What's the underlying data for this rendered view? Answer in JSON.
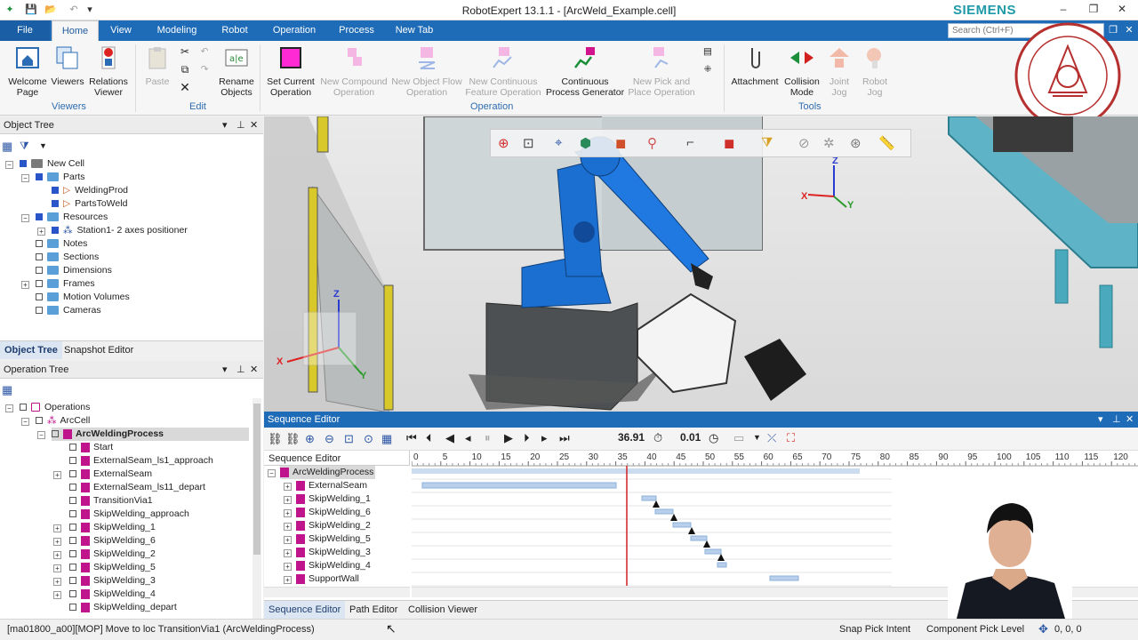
{
  "window": {
    "title": "RobotExpert 13.1.1 - [ArcWeld_Example.cell]",
    "brand": "SIEMENS",
    "minimize": "–",
    "restore": "❐",
    "close": "✕"
  },
  "tabs": [
    "File",
    "Home",
    "View",
    "Modeling",
    "Robot",
    "Operation",
    "Process",
    "New Tab"
  ],
  "search": {
    "placeholder": "Search (Ctrl+F)"
  },
  "ribbon": {
    "groups": [
      "Viewers",
      "Edit",
      "Operation",
      "Tools"
    ],
    "buttons": {
      "welcome": "Welcome Page",
      "viewers": "Viewers",
      "relations": "Relations Viewer",
      "paste": "Paste",
      "rename": "Rename Objects",
      "set_current": "Set Current Operation",
      "new_compound": "New Compound Operation",
      "new_object_flow": "New Object Flow Operation",
      "new_continuous": "New Continuous Feature Operation",
      "continuous_generator": "Continuous Process Generator",
      "new_pick_place": "New Pick and Place Operation",
      "attachment": "Attachment",
      "collision": "Collision Mode",
      "joint_jog": "Joint Jog",
      "robot_jog": "Robot Jog"
    }
  },
  "object_tree": {
    "title": "Object Tree",
    "items": [
      "New Cell",
      "Parts",
      "WeldingProd",
      "PartsToWeld",
      "Resources",
      "Station1- 2 axes positioner",
      "Notes",
      "Sections",
      "Dimensions",
      "Frames",
      "Motion Volumes",
      "Cameras"
    ],
    "bottom_tabs": [
      "Object Tree",
      "Snapshot Editor"
    ]
  },
  "operation_tree": {
    "title": "Operation Tree",
    "items": [
      "Operations",
      "ArcCell",
      "ArcWeldingProcess",
      "Start",
      "ExternalSeam_ls1_approach",
      "ExternalSeam",
      "ExternalSeam_ls11_depart",
      "TransitionVia1",
      "SkipWelding_approach",
      "SkipWelding_1",
      "SkipWelding_6",
      "SkipWelding_2",
      "SkipWelding_5",
      "SkipWelding_3",
      "SkipWelding_4",
      "SkipWelding_depart"
    ]
  },
  "viewport": {
    "axis_labels": [
      "Z",
      "X",
      "Y"
    ]
  },
  "sequence_editor": {
    "title": "Sequence Editor",
    "current_time": "36.91",
    "time_step": "0.01",
    "column_header": "Sequence Editor",
    "rows": [
      "ArcWeldingProcess",
      "ExternalSeam",
      "SkipWelding_1",
      "SkipWelding_6",
      "SkipWelding_2",
      "SkipWelding_5",
      "SkipWelding_3",
      "SkipWelding_4",
      "SupportWall"
    ],
    "ruler_ticks": [
      "0",
      "5",
      "10",
      "15",
      "20",
      "25",
      "30",
      "35",
      "40",
      "45",
      "50",
      "55",
      "60",
      "65",
      "70",
      "75",
      "80",
      "85",
      "90",
      "95",
      "100",
      "105",
      "110",
      "115",
      "120"
    ],
    "bottom_tabs": [
      "Sequence Editor",
      "Path Editor",
      "Collision Viewer"
    ]
  },
  "status": {
    "message": "[ma01800_a00][MOP] Move to loc TransitionVia1 (ArcWeldingProcess)",
    "snap": "Snap Pick Intent",
    "pick_level": "Component Pick Level",
    "coords": "0, 0, 0"
  },
  "colors": {
    "accent": "#1e6bb8",
    "brand": "#1f9aa7",
    "robot": "#1a6fd0",
    "timeline_bar": "#b8d0ec",
    "time_cursor": "#d22222"
  }
}
